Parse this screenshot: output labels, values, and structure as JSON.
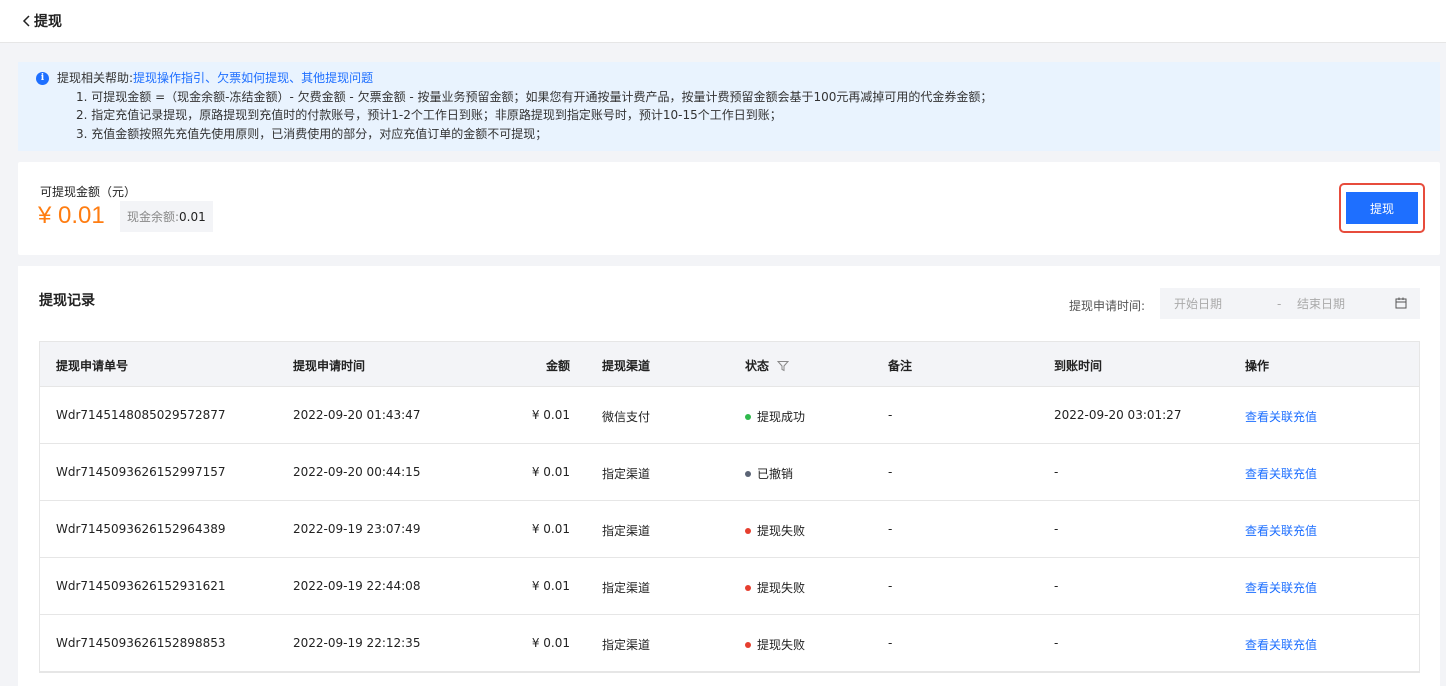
{
  "header": {
    "title": "提现"
  },
  "notice": {
    "prefix": "提现相关帮助:",
    "links": [
      "提现操作指引",
      "欠票如何提现",
      "其他提现问题"
    ],
    "separator": "、",
    "lines": [
      "1. 可提现金额 =（现金余额-冻结金额）- 欠费金额 - 欠票金额 - 按量业务预留金额；如果您有开通按量计费产品，按量计费预留金额会基于100元再减掉可用的代金券金额；",
      "2. 指定充值记录提现，原路提现到充值时的付款账号，预计1-2个工作日到账；非原路提现到指定账号时，预计10-15个工作日到账；",
      "3. 充值金额按照先充值先使用原则，已消费使用的部分，对应充值订单的金额不可提现；"
    ]
  },
  "balance": {
    "label": "可提现金额（元）",
    "amount": "¥ 0.01",
    "cash_label": "现金余额:",
    "cash_value": "0.01",
    "withdraw_button": "提现"
  },
  "records": {
    "title": "提现记录",
    "date_label": "提现申请时间:",
    "start_placeholder": "开始日期",
    "dash": "-",
    "end_placeholder": "结束日期",
    "columns": [
      "提现申请单号",
      "提现申请时间",
      "金额",
      "提现渠道",
      "状态",
      "备注",
      "到账时间",
      "操作"
    ],
    "rows": [
      {
        "id": "Wdr7145148085029572877",
        "time": "2022-09-20 01:43:47",
        "amount": "¥ 0.01",
        "channel": "微信支付",
        "status": "提现成功",
        "status_color": "#2fb94c",
        "note": "-",
        "arrive": "2022-09-20 03:01:27",
        "op": "查看关联充值"
      },
      {
        "id": "Wdr7145093626152997157",
        "time": "2022-09-20 00:44:15",
        "amount": "¥ 0.01",
        "channel": "指定渠道",
        "status": "已撤销",
        "status_color": "#5b6475",
        "note": "-",
        "arrive": "-",
        "op": "查看关联充值"
      },
      {
        "id": "Wdr7145093626152964389",
        "time": "2022-09-19 23:07:49",
        "amount": "¥ 0.01",
        "channel": "指定渠道",
        "status": "提现失败",
        "status_color": "#e63e2e",
        "note": "-",
        "arrive": "-",
        "op": "查看关联充值"
      },
      {
        "id": "Wdr7145093626152931621",
        "time": "2022-09-19 22:44:08",
        "amount": "¥ 0.01",
        "channel": "指定渠道",
        "status": "提现失败",
        "status_color": "#e63e2e",
        "note": "-",
        "arrive": "-",
        "op": "查看关联充值"
      },
      {
        "id": "Wdr7145093626152898853",
        "time": "2022-09-19 22:12:35",
        "amount": "¥ 0.01",
        "channel": "指定渠道",
        "status": "提现失败",
        "status_color": "#e63e2e",
        "note": "-",
        "arrive": "-",
        "op": "查看关联充值"
      }
    ]
  }
}
